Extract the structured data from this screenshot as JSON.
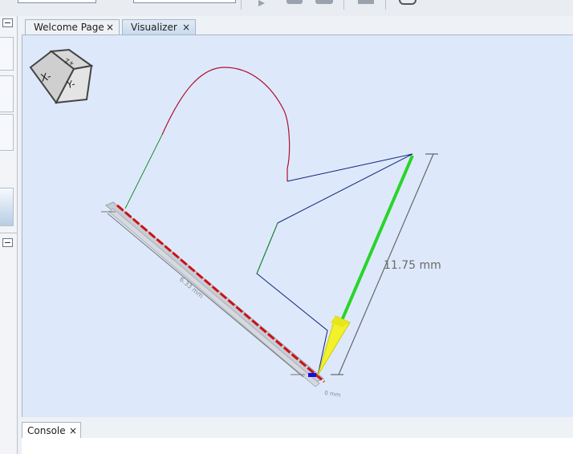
{
  "tabs": [
    {
      "label": "Welcome Page",
      "close": "×"
    },
    {
      "label": "Visualizer",
      "close": "×"
    }
  ],
  "console": {
    "label": "Console",
    "close": "×"
  },
  "viewport": {
    "cube": {
      "faces": [
        "X-",
        "Y-",
        "Z+"
      ]
    },
    "measurements": {
      "vertical": "11.75 mm",
      "diagonal": "6.33 mm",
      "bottom": "0 mm"
    }
  },
  "colors": {
    "viewport_bg": "#dde9fa",
    "arc": "#b01030",
    "rapid": "#1b8f2a",
    "feed": "#102080",
    "tool": "#f2f22a",
    "path_highlight": "#2ad42a",
    "axis_red": "#d01010"
  }
}
